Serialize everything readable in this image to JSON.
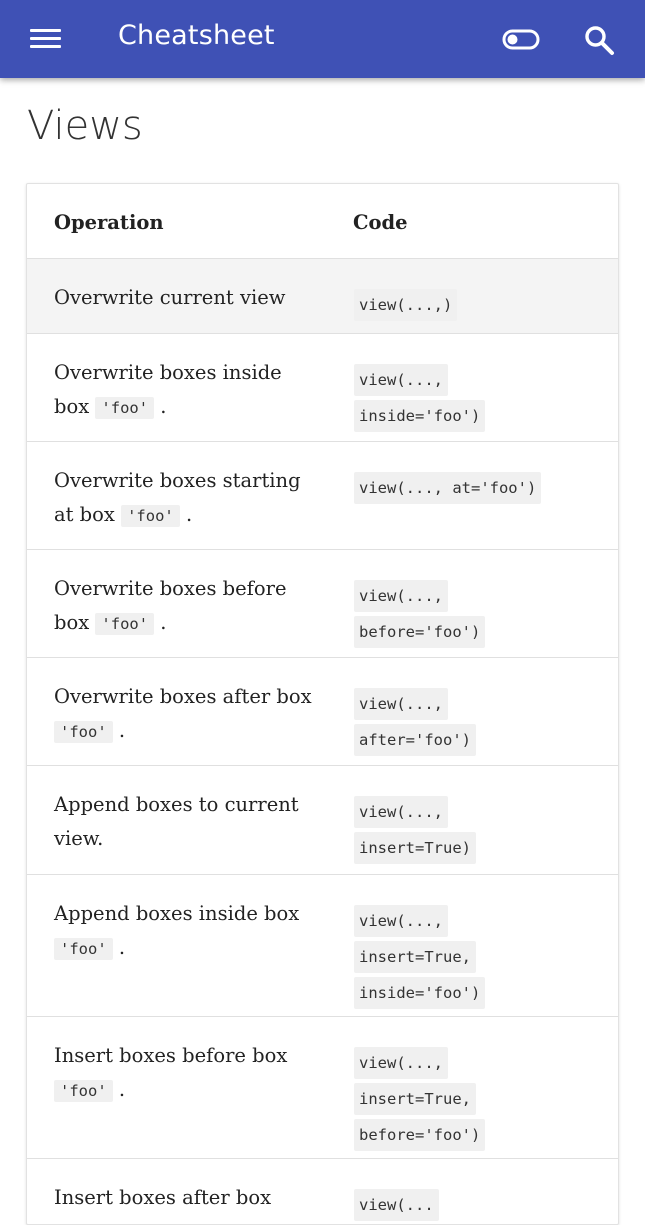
{
  "appbar": {
    "title": "Cheatsheet",
    "bg_color": "#3f51b5",
    "menu_icon": "menu-icon",
    "toggle_icon": "toggle-icon",
    "search_icon": "search-icon"
  },
  "page": {
    "title": "Views"
  },
  "table": {
    "headers": {
      "operation": "Operation",
      "code": "Code"
    },
    "rows": [
      {
        "op_text": "Overwrite current view",
        "op_code": "",
        "op_suffix": "",
        "code_lines": [
          "view(...,)"
        ]
      },
      {
        "op_text": "Overwrite boxes inside box",
        "op_code": "'foo'",
        "op_suffix": ".",
        "code_lines": [
          "view(...,",
          "inside='foo')"
        ]
      },
      {
        "op_text": "Overwrite boxes starting at box",
        "op_code": "'foo'",
        "op_suffix": ".",
        "code_lines": [
          "view(..., at='foo')"
        ]
      },
      {
        "op_text": "Overwrite boxes before box",
        "op_code": "'foo'",
        "op_suffix": ".",
        "code_lines": [
          "view(...,",
          "before='foo')"
        ]
      },
      {
        "op_text": "Overwrite boxes after box",
        "op_code": "'foo'",
        "op_suffix": ".",
        "code_lines": [
          "view(...,",
          "after='foo')"
        ]
      },
      {
        "op_text": "Append boxes to current view.",
        "op_code": "",
        "op_suffix": "",
        "code_lines": [
          "view(...,",
          "insert=True)"
        ]
      },
      {
        "op_text": "Append boxes inside box",
        "op_code": "'foo'",
        "op_suffix": ".",
        "code_lines": [
          "view(...,",
          "insert=True,",
          "inside='foo')"
        ]
      },
      {
        "op_text": "Insert boxes before box",
        "op_code": "'foo'",
        "op_suffix": ".",
        "code_lines": [
          "view(...,",
          "insert=True,",
          "before='foo')"
        ]
      },
      {
        "op_text": "Insert boxes after box",
        "op_code": "",
        "op_suffix": "",
        "code_lines": [
          "view(..."
        ]
      }
    ]
  }
}
